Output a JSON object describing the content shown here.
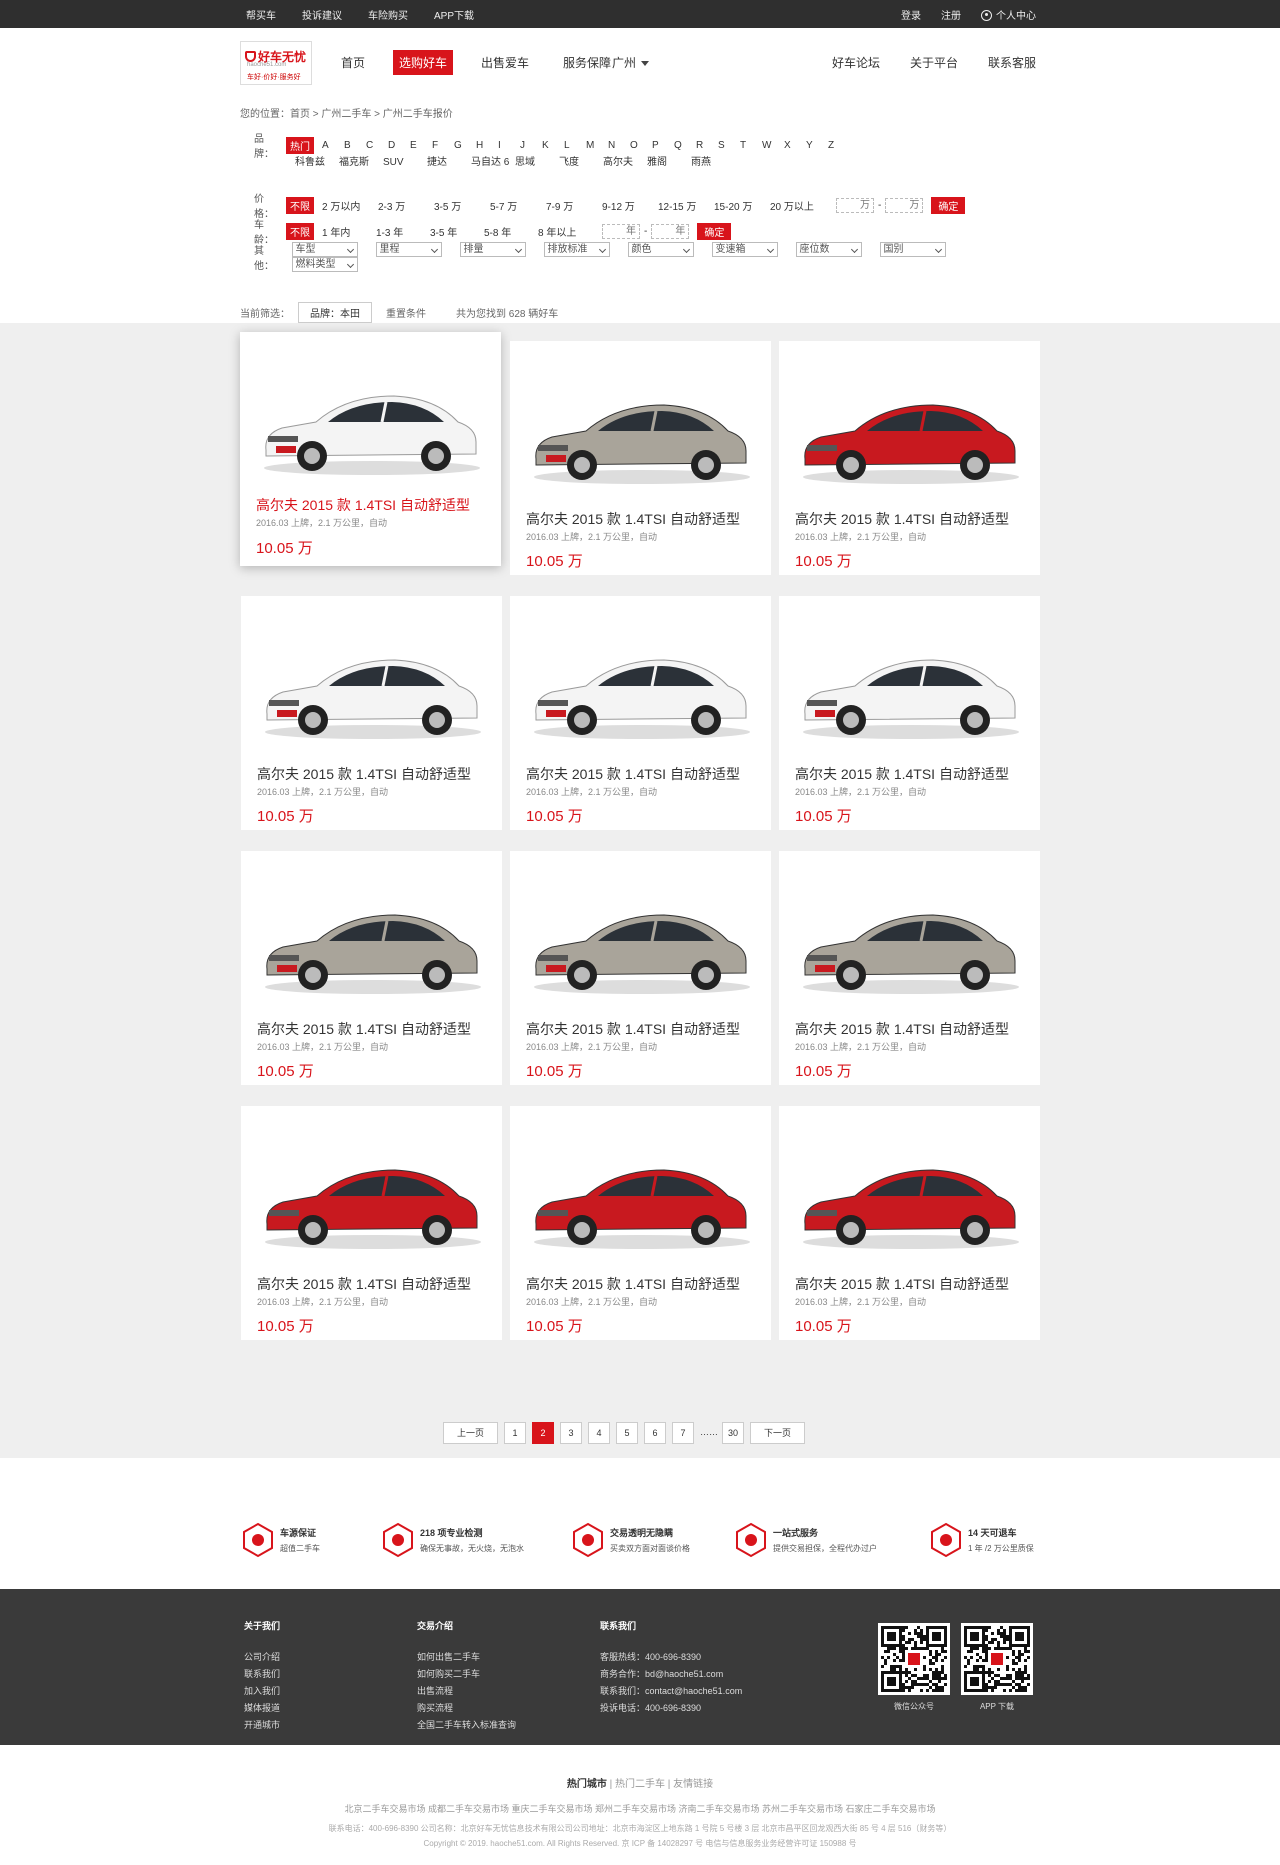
{
  "topbar": {
    "left": [
      "帮买车",
      "投诉建议",
      "车险购买",
      "APP下载"
    ],
    "login": "登录",
    "register": "注册",
    "user_center": "个人中心"
  },
  "header": {
    "logo_title": "好车无忧",
    "logo_sub": "haoche51.com",
    "logo_slogan": "车好·价好·服务好",
    "nav": [
      "首页",
      "选购好车",
      "出售爱车",
      "服务保障"
    ],
    "city": "广州",
    "nav_right": [
      "好车论坛",
      "关于平台",
      "联系客服"
    ]
  },
  "breadcrumb": {
    "label": "您的位置：",
    "path": "首页 > 广州二手车 > 广州二手车报价"
  },
  "filter": {
    "brand_label": "品牌：",
    "hot": "热门",
    "letters": [
      "A",
      "B",
      "C",
      "D",
      "E",
      "F",
      "G",
      "H",
      "I",
      "J",
      "K",
      "L",
      "M",
      "N",
      "O",
      "P",
      "Q",
      "R",
      "S",
      "T",
      "W",
      "X",
      "Y",
      "Z"
    ],
    "brands": [
      "科鲁兹",
      "福克斯",
      "SUV",
      "捷达",
      "马自达 6",
      "思域",
      "飞度",
      "高尔夫",
      "雅阁",
      "雨燕"
    ],
    "price_label": "价格：",
    "unlimited": "不限",
    "prices": [
      "2 万以内",
      "2-3 万",
      "3-5 万",
      "5-7 万",
      "7-9 万",
      "9-12 万",
      "12-15 万",
      "15-20 万",
      "20 万以上"
    ],
    "price_unit": "万",
    "confirm": "确定",
    "age_label": "车龄：",
    "ages": [
      "1 年内",
      "1-3 年",
      "3-5 年",
      "5-8 年",
      "8 年以上"
    ],
    "age_unit": "年",
    "other_label": "其他：",
    "selects": [
      "车型",
      "里程",
      "排量",
      "排放标准",
      "颜色",
      "变速箱",
      "座位数",
      "国别",
      "燃料类型"
    ]
  },
  "current": {
    "label": "当前筛选：",
    "chip": "品牌：本田",
    "reset": "重置条件",
    "result": "共为您找到 628 辆好车"
  },
  "listings": [
    {
      "title": "高尔夫 2015 款 1.4TSI 自动舒适型",
      "spec": "2016.03 上牌，2.1 万公里，自动",
      "price": "10.05 万",
      "color": "white"
    },
    {
      "title": "高尔夫 2015 款 1.4TSI 自动舒适型",
      "spec": "2016.03 上牌，2.1 万公里，自动",
      "price": "10.05 万",
      "color": "silver"
    },
    {
      "title": "高尔夫 2015 款 1.4TSI 自动舒适型",
      "spec": "2016.03 上牌，2.1 万公里，自动",
      "price": "10.05 万",
      "color": "red"
    },
    {
      "title": "高尔夫 2015 款 1.4TSI 自动舒适型",
      "spec": "2016.03 上牌，2.1 万公里，自动",
      "price": "10.05 万",
      "color": "white"
    },
    {
      "title": "高尔夫 2015 款 1.4TSI 自动舒适型",
      "spec": "2016.03 上牌，2.1 万公里，自动",
      "price": "10.05 万",
      "color": "white"
    },
    {
      "title": "高尔夫 2015 款 1.4TSI 自动舒适型",
      "spec": "2016.03 上牌，2.1 万公里，自动",
      "price": "10.05 万",
      "color": "white"
    },
    {
      "title": "高尔夫 2015 款 1.4TSI 自动舒适型",
      "spec": "2016.03 上牌，2.1 万公里，自动",
      "price": "10.05 万",
      "color": "silver"
    },
    {
      "title": "高尔夫 2015 款 1.4TSI 自动舒适型",
      "spec": "2016.03 上牌，2.1 万公里，自动",
      "price": "10.05 万",
      "color": "silver"
    },
    {
      "title": "高尔夫 2015 款 1.4TSI 自动舒适型",
      "spec": "2016.03 上牌，2.1 万公里，自动",
      "price": "10.05 万",
      "color": "silver"
    },
    {
      "title": "高尔夫 2015 款 1.4TSI 自动舒适型",
      "spec": "2016.03 上牌，2.1 万公里，自动",
      "price": "10.05 万",
      "color": "red"
    },
    {
      "title": "高尔夫 2015 款 1.4TSI 自动舒适型",
      "spec": "2016.03 上牌，2.1 万公里，自动",
      "price": "10.05 万",
      "color": "red"
    },
    {
      "title": "高尔夫 2015 款 1.4TSI 自动舒适型",
      "spec": "2016.03 上牌，2.1 万公里，自动",
      "price": "10.05 万",
      "color": "red"
    }
  ],
  "car_colors": {
    "white": "#f4f4f4",
    "silver": "#a9a49a",
    "red": "#c8191f"
  },
  "pager": {
    "prev": "上一页",
    "pages": [
      "1",
      "2",
      "3",
      "4",
      "5",
      "6",
      "7"
    ],
    "dots": "……",
    "last": "30",
    "next": "下一页",
    "current": "2"
  },
  "services": [
    {
      "t1": "车源保证",
      "t2": "超值二手车"
    },
    {
      "t1": "218 项专业检测",
      "t2": "确保无事故，无火烧，无泡水"
    },
    {
      "t1": "交易透明无隐瞒",
      "t2": "买卖双方面对面谈价格"
    },
    {
      "t1": "一站式服务",
      "t2": "提供交易担保，全程代办过户"
    },
    {
      "t1": "14 天可退车",
      "t2": "1 年 /2 万公里质保"
    }
  ],
  "footer": {
    "about": {
      "h": "关于我们",
      "items": [
        "公司介绍",
        "联系我们",
        "加入我们",
        "媒体报道",
        "开通城市"
      ]
    },
    "trade": {
      "h": "交易介绍",
      "items": [
        "如何出售二手车",
        "如何购买二手车",
        "出售流程",
        "购买流程",
        "全国二手车转入标准查询"
      ]
    },
    "contact": {
      "h": "联系我们",
      "items": [
        "客服热线：400-696-8390",
        "商务合作：bd@haoche51.com",
        "联系我们：contact@haoche51.com",
        "投诉电话：400-696-8390"
      ]
    },
    "qr1": "微信公众号",
    "qr2": "APP 下载"
  },
  "bottom": {
    "links": [
      "热门城市",
      "热门二手车",
      "友情链接"
    ],
    "cities": "北京二手车交易市场 成都二手车交易市场 重庆二手车交易市场 郑州二手车交易市场 济南二手车交易市场 苏州二手车交易市场 石家庄二手车交易市场",
    "legal1": "联系电话：400-696-8390 公司名称：北京好车无忧信息技术有限公司公司地址：北京市海淀区上地东路 1 号院 5 号楼 3 层 北京市昌平区回龙观西大街 85 号 4 层 516（财务等）",
    "legal2": "Copyright © 2019. haoche51.com. All Rights Reserved. 京 ICP 备 14028297 号 电信与信息服务业务经营许可证 150988 号"
  },
  "colors": {
    "accent": "#d8141b",
    "topbar": "#2f2f2f",
    "footer": "#3a3a3a"
  }
}
